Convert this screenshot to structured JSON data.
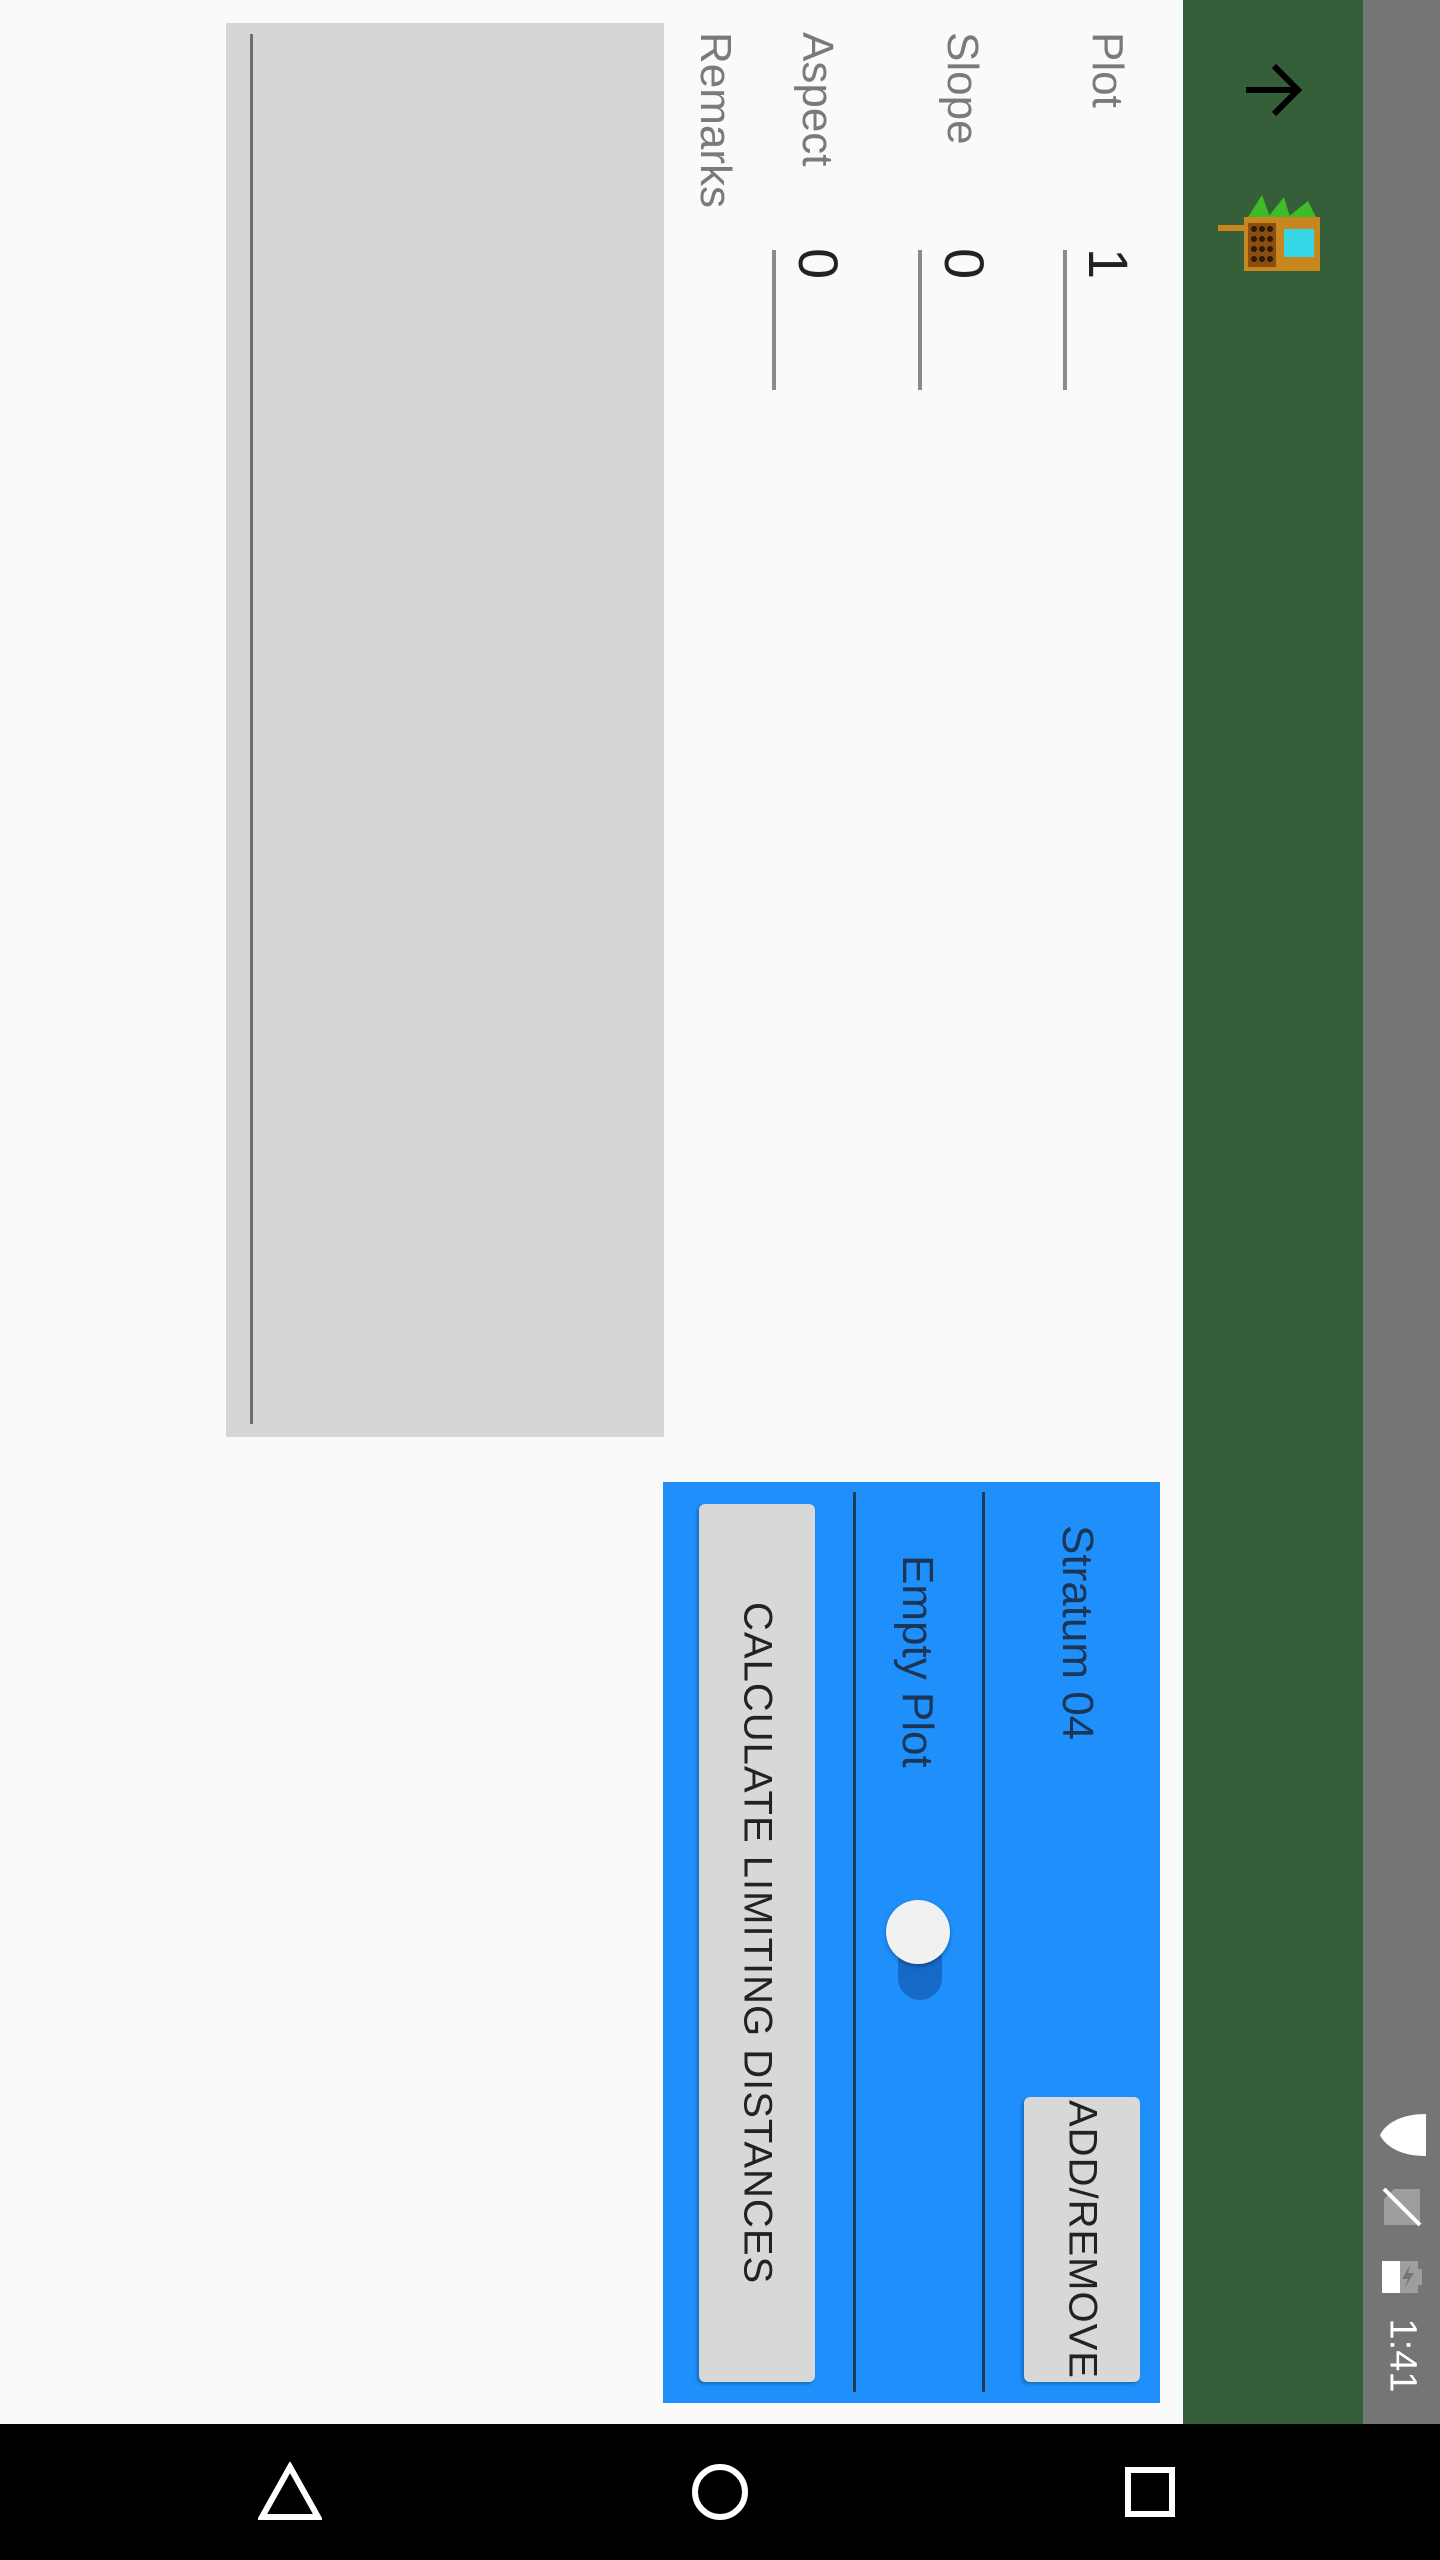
{
  "status_bar": {
    "time": "1:41",
    "icons": [
      "wifi-icon",
      "no-sim-icon",
      "battery-icon"
    ]
  },
  "app_bar": {
    "back_icon": "arrow-back-icon",
    "logo_icon": "cruise-logo-icon"
  },
  "form": {
    "plot_label": "Plot",
    "plot_value": "1",
    "slope_label": "Slope",
    "slope_value": "0",
    "aspect_label": "Aspect",
    "aspect_value": "0",
    "remarks_label": "Remarks",
    "remarks_value": ""
  },
  "panel": {
    "stratum_label": "Stratum 04",
    "add_remove_label": "ADD/REMOVE",
    "empty_plot_label": "Empty Plot",
    "empty_plot_on": true,
    "calculate_label": "CALCULATE LIMITING DISTANCES"
  },
  "nav_bar": {
    "back": "back-triangle-icon",
    "home": "home-circle-icon",
    "recents": "recents-square-icon"
  },
  "colors": {
    "app_bar": "#355f39",
    "panel": "#1f8ffc",
    "status_bar": "#757575"
  }
}
